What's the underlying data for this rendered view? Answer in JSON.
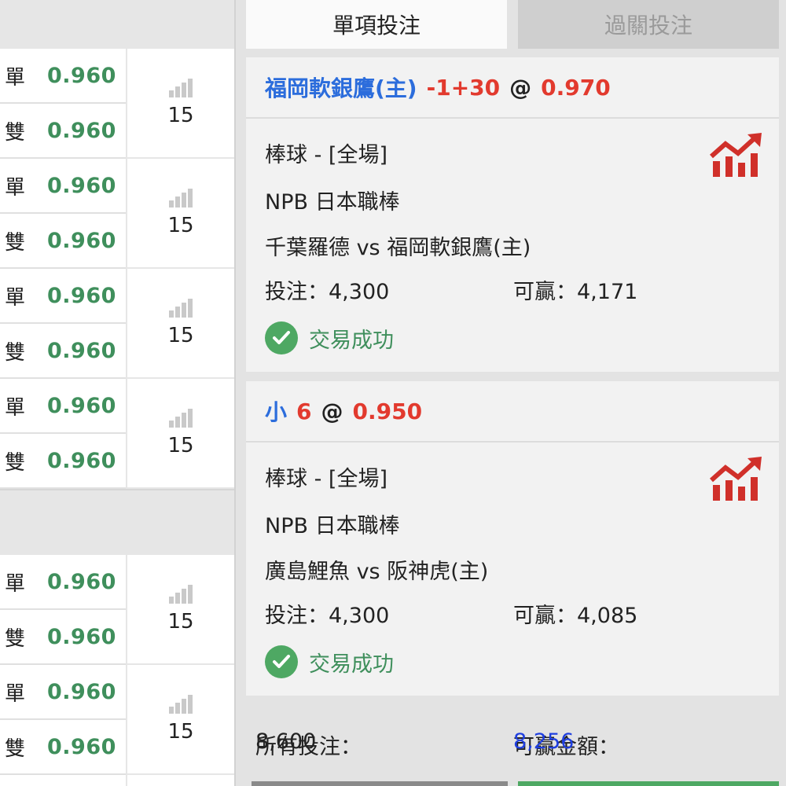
{
  "colors": {
    "odds_green": "#3f8f5c",
    "team_blue": "#2c6ddc",
    "accent_red": "#e23a2e",
    "win_blue": "#1f3fe0",
    "success_green": "#4ea863"
  },
  "odds_groups": [
    {
      "rows": [
        {
          "label": "單",
          "odds": "0.960"
        },
        {
          "label": "雙",
          "odds": "0.960"
        }
      ],
      "count": "15"
    },
    {
      "rows": [
        {
          "label": "單",
          "odds": "0.960"
        },
        {
          "label": "雙",
          "odds": "0.960"
        }
      ],
      "count": "15"
    },
    {
      "rows": [
        {
          "label": "單",
          "odds": "0.960"
        },
        {
          "label": "雙",
          "odds": "0.960"
        }
      ],
      "count": "15"
    },
    {
      "rows": [
        {
          "label": "單",
          "odds": "0.960"
        },
        {
          "label": "雙",
          "odds": "0.960"
        }
      ],
      "count": "15"
    },
    {
      "rows": [
        {
          "label": "單",
          "odds": "0.960"
        },
        {
          "label": "雙",
          "odds": "0.960"
        }
      ],
      "count": "15"
    },
    {
      "rows": [
        {
          "label": "單",
          "odds": "0.960"
        },
        {
          "label": "雙",
          "odds": "0.960"
        }
      ],
      "count": "15"
    }
  ],
  "tabs": {
    "single": "單項投注",
    "parlay": "過關投注"
  },
  "bets": [
    {
      "selection": "福岡軟銀鷹(主)",
      "handicap": "-1+30",
      "at": "@",
      "odds": "0.970",
      "sport": "棒球 - [全場]",
      "league": "NPB 日本職棒",
      "match": "千葉羅德 vs 福岡軟銀鷹(主)",
      "stake_label": "投注：",
      "stake": "4,300",
      "win_label": "可贏：",
      "win": "4,171",
      "status": "交易成功",
      "trend_icon": "trend-chart-icon"
    },
    {
      "selection": "小",
      "handicap": "6",
      "at": "@",
      "odds": "0.950",
      "sport": "棒球 - [全場]",
      "league": "NPB 日本職棒",
      "match": "廣島鯉魚 vs 阪神虎(主)",
      "stake_label": "投注：",
      "stake": "4,300",
      "win_label": "可贏：",
      "win": "4,085",
      "status": "交易成功",
      "trend_icon": "trend-chart-icon"
    }
  ],
  "summary": {
    "total_label": "所有投注：",
    "total": "8,600",
    "win_label": "可贏金額：",
    "win": "8,256"
  }
}
